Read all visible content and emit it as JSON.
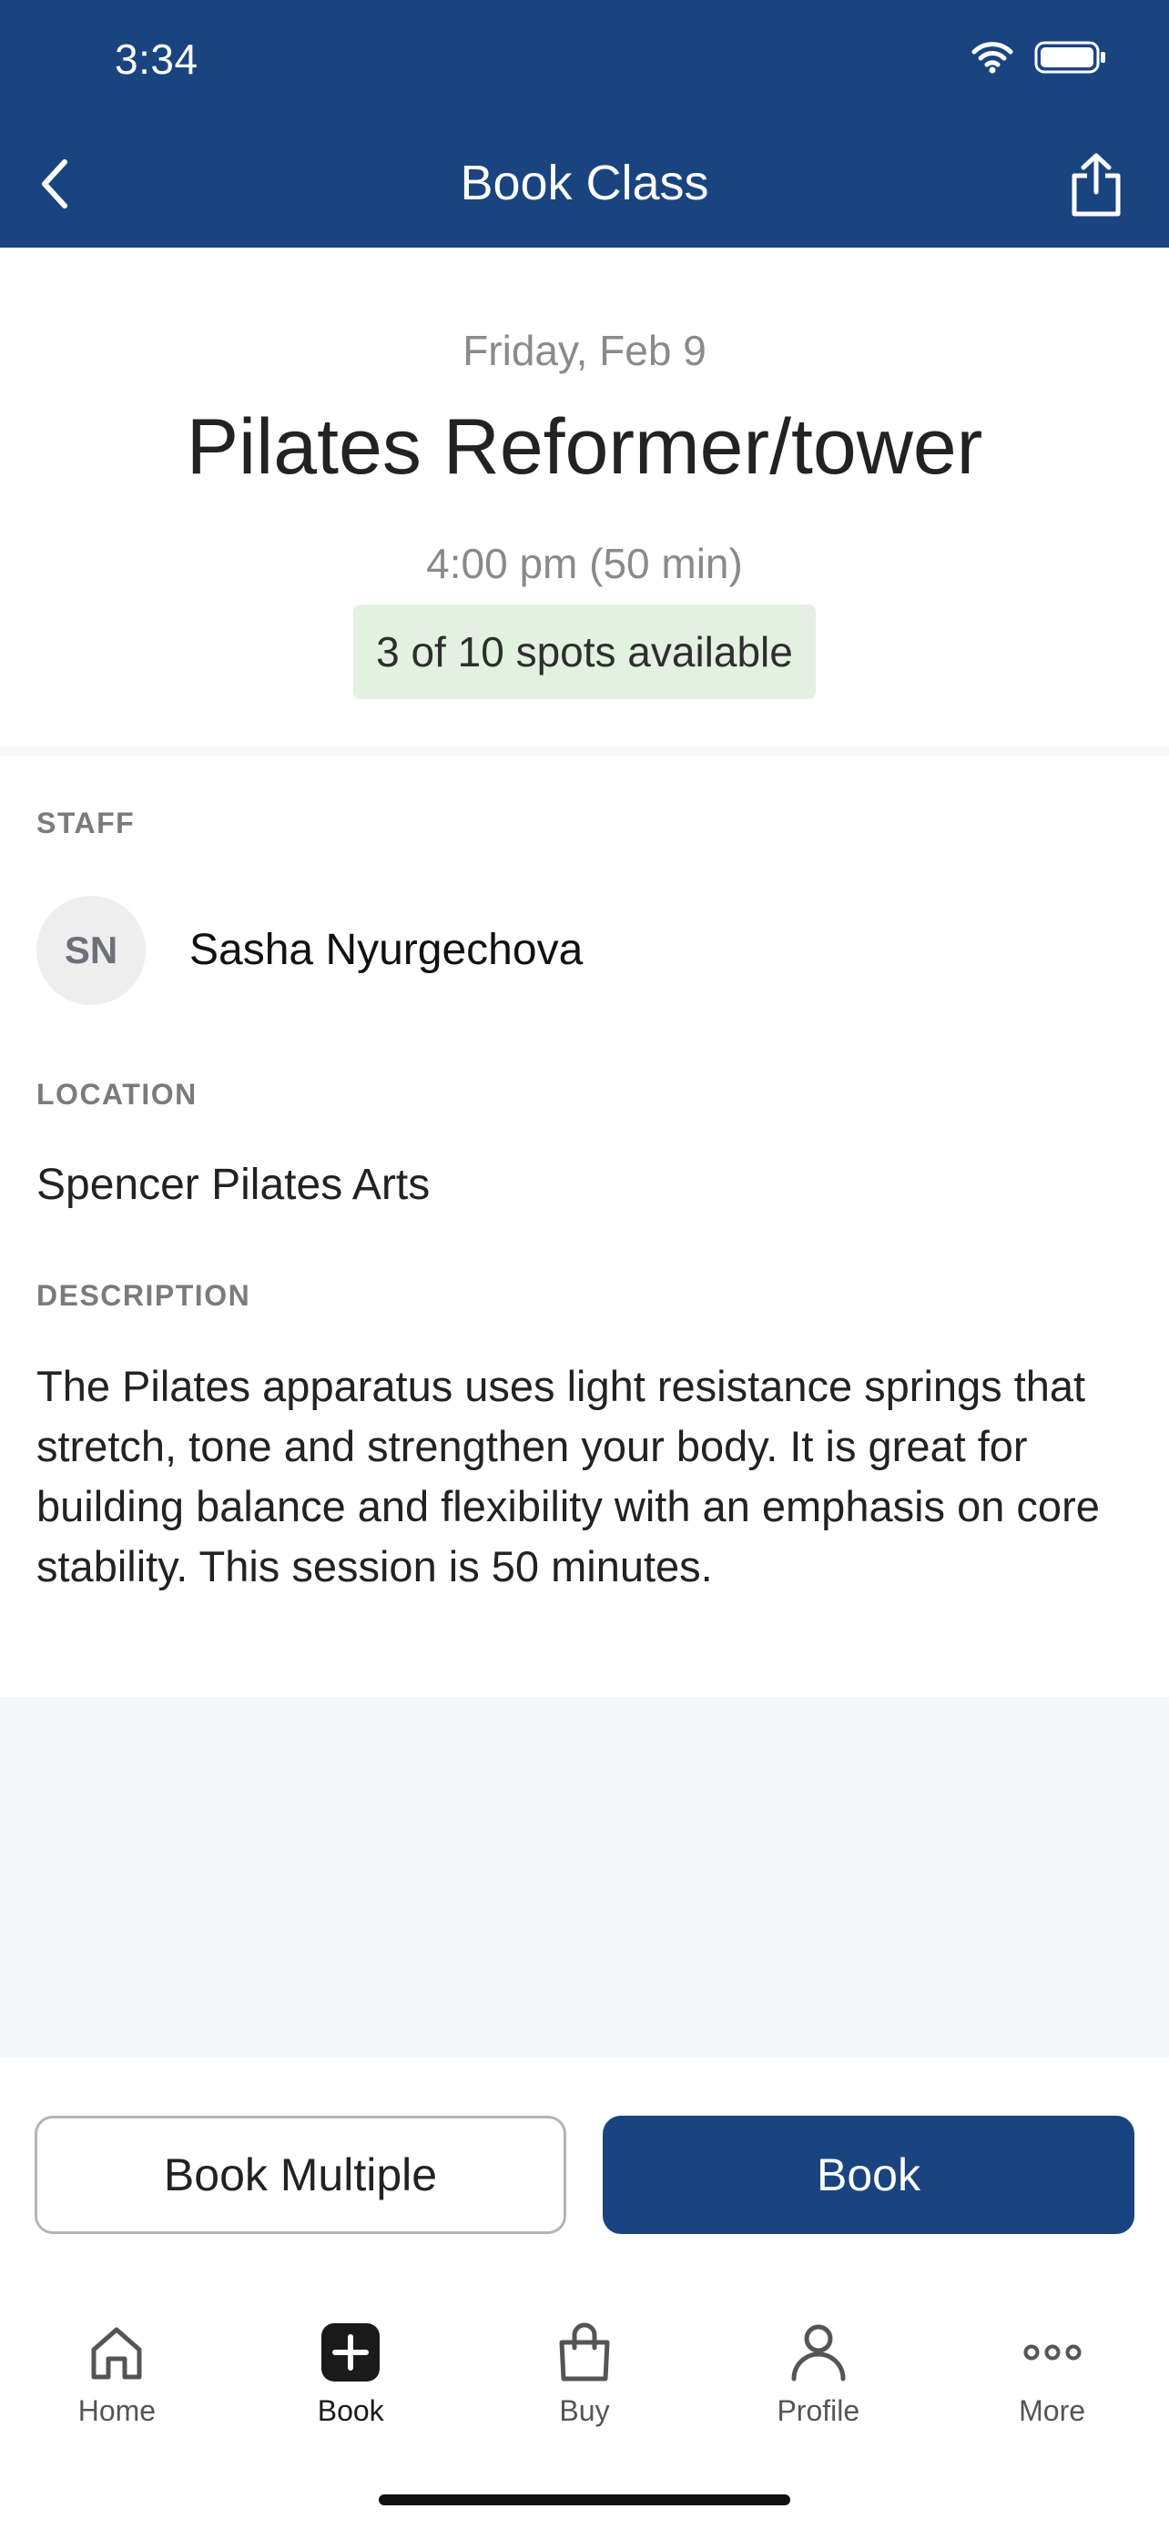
{
  "status_bar": {
    "time": "3:34"
  },
  "nav": {
    "title": "Book Class"
  },
  "class": {
    "date": "Friday, Feb 9",
    "title": "Pilates Reformer/tower",
    "time": "4:00 pm (50 min)",
    "spots": "3 of 10 spots available"
  },
  "staff": {
    "label": "STAFF",
    "initials": "SN",
    "name": "Sasha Nyurgechova"
  },
  "location": {
    "label": "LOCATION",
    "name": "Spencer Pilates Arts"
  },
  "description": {
    "label": "DESCRIPTION",
    "text": "The Pilates apparatus uses light resistance springs that stretch, tone and strengthen your body. It is great for building balance and flexibility with an emphasis on core stability. This session is 50 minutes."
  },
  "actions": {
    "book_multiple": "Book Multiple",
    "book": "Book"
  },
  "tabbar": {
    "items": [
      {
        "label": "Home",
        "icon": "home-icon",
        "active": false
      },
      {
        "label": "Book",
        "icon": "plus-square-icon",
        "active": true
      },
      {
        "label": "Buy",
        "icon": "shopping-bag-icon",
        "active": false
      },
      {
        "label": "Profile",
        "icon": "person-icon",
        "active": false
      },
      {
        "label": "More",
        "icon": "ellipsis-icon",
        "active": false
      }
    ]
  },
  "colors": {
    "brand": "#1a4480",
    "spots_bg": "#e3f1e1",
    "muted": "#8a8a8a",
    "page_gray": "#f6f7f9"
  }
}
